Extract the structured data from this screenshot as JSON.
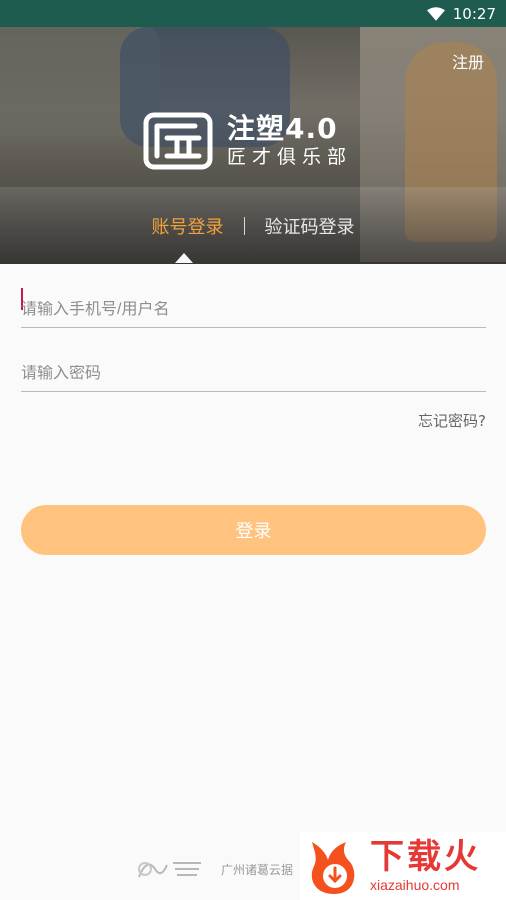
{
  "status_bar": {
    "time": "10:27"
  },
  "header": {
    "register": "注册",
    "logo_line1": "注塑4.0",
    "logo_line2": "匠才俱乐部",
    "tabs": [
      {
        "label": "账号登录",
        "active": true
      },
      {
        "label": "验证码登录",
        "active": false
      }
    ]
  },
  "form": {
    "username_placeholder": "请输入手机号/用户名",
    "password_placeholder": "请输入密码",
    "forgot": "忘记密码?",
    "login": "登录"
  },
  "footer": {
    "company": "广州诸葛云据"
  },
  "watermark": {
    "title": "下载火",
    "domain": "xiazaihuo.com"
  },
  "colors": {
    "accent": "#f3a23b",
    "button": "#ffc37f",
    "status": "#1f5c50"
  }
}
